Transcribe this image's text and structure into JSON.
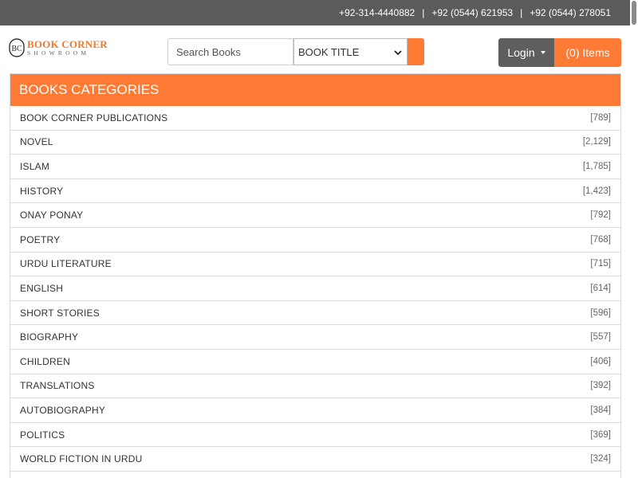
{
  "topbar": {
    "phones": [
      "+92-314-4440882",
      "+92 (0544) 621953",
      "+92 (0544) 278051"
    ],
    "separator": "|"
  },
  "logo": {
    "monogram": "BC",
    "title": "BOOK CORNER",
    "subtitle": "SHOWROOM"
  },
  "search": {
    "placeholder": "Search Books",
    "value": "",
    "select_value": "BOOK TITLE"
  },
  "header": {
    "login_label": "Login",
    "cart_label": "(0) Items"
  },
  "categories": {
    "title": "BOOKS CATEGORIES",
    "items": [
      {
        "name": "BOOK CORNER PUBLICATIONS",
        "count": "[789]"
      },
      {
        "name": "NOVEL",
        "count": "[2,129]"
      },
      {
        "name": "ISLAM",
        "count": "[1,785]"
      },
      {
        "name": "HISTORY",
        "count": "[1,423]"
      },
      {
        "name": "ONAY PONAY",
        "count": "[792]"
      },
      {
        "name": "POETRY",
        "count": "[768]"
      },
      {
        "name": "URDU LITERATURE",
        "count": "[715]"
      },
      {
        "name": "ENGLISH",
        "count": "[614]"
      },
      {
        "name": "SHORT STORIES",
        "count": "[596]"
      },
      {
        "name": "BIOGRAPHY",
        "count": "[557]"
      },
      {
        "name": "CHILDREN",
        "count": "[406]"
      },
      {
        "name": "TRANSLATIONS",
        "count": "[392]"
      },
      {
        "name": "AUTOBIOGRAPHY",
        "count": "[384]"
      },
      {
        "name": "POLITICS",
        "count": "[369]"
      },
      {
        "name": "WORLD FICTION IN URDU",
        "count": "[324]"
      },
      {
        "name": "",
        "count": ""
      }
    ]
  },
  "colors": {
    "accent": "#ff7a35",
    "topbar": "#5b5b5b",
    "login": "#5e5e5e"
  }
}
